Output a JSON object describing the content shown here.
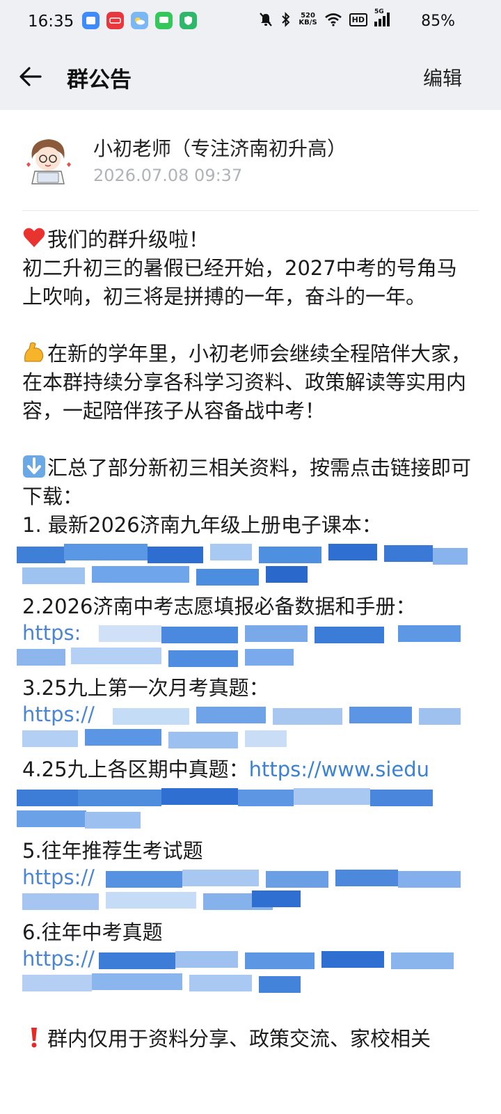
{
  "status_bar": {
    "time": "16:35",
    "speed_value": "520",
    "speed_unit": "KB/S",
    "hd_label": "HD",
    "network_label": "5G",
    "battery": "85%"
  },
  "title_bar": {
    "title": "群公告",
    "edit_label": "编辑"
  },
  "announcement": {
    "author": "小初老师（专注济南初升高）",
    "timestamp": "2026.07.08 09:37",
    "para1_line1": "我们的群升级啦！",
    "para1_line2": "初二升初三的暑假已经开始，2027中考的号角马上吹响，初三将是拼搏的一年，奋斗的一年。",
    "para2": "在新的学年里，小初老师会继续全程陪伴大家，在本群持续分享各科学习资料、政策解读等实用内容，一起陪伴孩子从容备战中考！",
    "para3": "汇总了部分新初三相关资料，按需点击链接即可下载：",
    "items": [
      {
        "label": "1. 最新2026济南九年级上册电子课本：",
        "link_start": ""
      },
      {
        "label": "2.2026济南中考志愿填报必备数据和手册：",
        "link_start": "https:"
      },
      {
        "label": "3.25九上第一次月考真题：",
        "link_start": "https://"
      },
      {
        "label": "4.25九上各区期中真题：",
        "link_start": "https://www.siedu"
      },
      {
        "label": "5.往年推荐生考试题",
        "link_start": "https://"
      },
      {
        "label": "6.往年中考真题",
        "link_start": "https://"
      }
    ],
    "para4": "群内仅用于资料分享、政策交流、家校相关"
  },
  "colors": {
    "link": "#3b82d6",
    "topbar_bg": "#eef0f4",
    "muted": "#b0b3b8"
  },
  "icons": {
    "back": "arrow-left-icon",
    "heart": "red-heart-emoji",
    "muscle": "flexed-biceps-emoji",
    "down": "down-arrow-emoji",
    "exclamation": "red-exclamation-emoji"
  }
}
